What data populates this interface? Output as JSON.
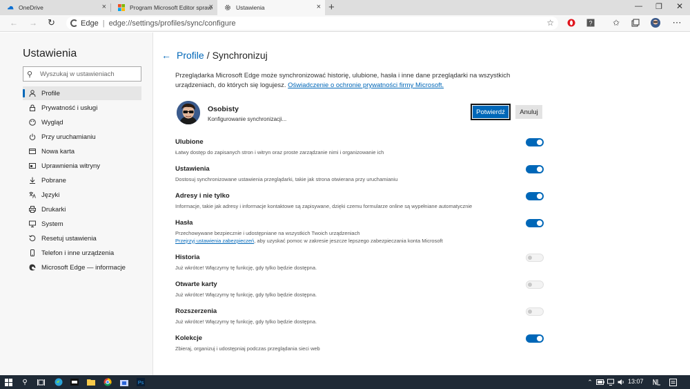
{
  "tabs": [
    {
      "title": "OneDrive",
      "icon": "onedrive-icon",
      "active": false
    },
    {
      "title": "Program Microsoft Editor sprawdzi",
      "icon": "microsoft-logo-icon",
      "active": false
    },
    {
      "title": "Ustawienia",
      "icon": "settings-gear-icon",
      "active": true
    }
  ],
  "tab_close_glyph": "×",
  "new_tab_glyph": "+",
  "address": {
    "brand": "Edge",
    "separator": "|",
    "url": "edge://settings/profiles/sync/configure"
  },
  "sidebar": {
    "title": "Ustawienia",
    "search_placeholder": "Wyszukaj w ustawieniach",
    "items": [
      {
        "label": "Profile",
        "icon": "person-icon",
        "active": true
      },
      {
        "label": "Prywatność i usługi",
        "icon": "lock-icon",
        "active": false
      },
      {
        "label": "Wygląd",
        "icon": "palette-icon",
        "active": false
      },
      {
        "label": "Przy uruchamianiu",
        "icon": "power-icon",
        "active": false
      },
      {
        "label": "Nowa karta",
        "icon": "new-tab-icon",
        "active": false
      },
      {
        "label": "Uprawnienia witryny",
        "icon": "site-permissions-icon",
        "active": false
      },
      {
        "label": "Pobrane",
        "icon": "download-icon",
        "active": false
      },
      {
        "label": "Języki",
        "icon": "language-icon",
        "active": false
      },
      {
        "label": "Drukarki",
        "icon": "printer-icon",
        "active": false
      },
      {
        "label": "System",
        "icon": "system-icon",
        "active": false
      },
      {
        "label": "Resetuj ustawienia",
        "icon": "reset-icon",
        "active": false
      },
      {
        "label": "Telefon i inne urządzenia",
        "icon": "phone-icon",
        "active": false
      },
      {
        "label": "Microsoft Edge — informacje",
        "icon": "edge-logo-icon",
        "active": false
      }
    ]
  },
  "main": {
    "breadcrumb_parent": "Profile",
    "breadcrumb_separator": "/",
    "breadcrumb_current": "Synchronizuj",
    "intro_text": "Przeglądarka Microsoft Edge może synchronizować historię, ulubione, hasła i inne dane przeglądarki na wszystkich urządzeniach, do których się logujesz.",
    "intro_link": "Oświadczenie o ochronie prywatności firmy Microsoft.",
    "profile_name": "Osobisty",
    "profile_status": "Konfigurowanie synchronizacji...",
    "confirm_label": "Potwierdź",
    "cancel_label": "Anuluj",
    "settings": [
      {
        "title": "Ulubione",
        "desc": "Łatwy dostęp do zapisanych stron i witryn oraz proste zarządzanie nimi i organizowanie ich",
        "enabled": true
      },
      {
        "title": "Ustawienia",
        "desc": "Dostosuj synchronizowane ustawienia przeglądarki, takie jak strona otwierana przy uruchamianiu",
        "enabled": true
      },
      {
        "title": "Adresy i nie tylko",
        "desc": "Informacje, takie jak adresy i informacje kontaktowe są zapisywane, dzięki czemu formularze online są wypełniane automatycznie",
        "enabled": true
      },
      {
        "title": "Hasła",
        "desc": "Przechowywane bezpiecznie i udostępniane na wszystkich Twoich urządzeniach",
        "link": "Przejrzyj ustawienia zabezpieczeń",
        "link_suffix": ", aby uzyskać pomoc w zakresie jeszcze lepszego zabezpieczania konta Microsoft",
        "enabled": true
      },
      {
        "title": "Historia",
        "desc": "Już wkrótce! Włączymy tę funkcję, gdy tylko będzie dostępna.",
        "enabled": false
      },
      {
        "title": "Otwarte karty",
        "desc": "Już wkrótce! Włączymy tę funkcję, gdy tylko będzie dostępna.",
        "enabled": false
      },
      {
        "title": "Rozszerzenia",
        "desc": "Już wkrótce! Włączymy tę funkcję, gdy tylko będzie dostępna.",
        "enabled": false
      },
      {
        "title": "Kolekcje",
        "desc": "Zbieraj, organizuj i udostępniaj podczas przeglądania sieci web",
        "enabled": true
      }
    ]
  },
  "taskbar": {
    "time": "13:07"
  },
  "colors": {
    "accent": "#0067b8",
    "taskbar": "#1f2a36"
  }
}
